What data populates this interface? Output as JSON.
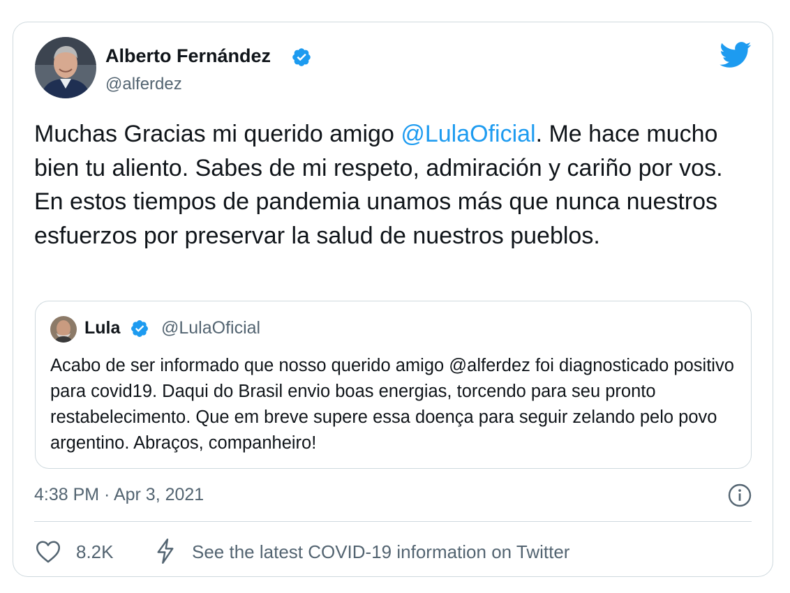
{
  "tweet": {
    "author": {
      "name": "Alberto Fernández",
      "handle": "@alferdez",
      "verified": true
    },
    "text": {
      "before_mention": "Muchas Gracias mi querido amigo ",
      "mention": "@LulaOficial",
      "after_mention": ". Me hace mucho bien tu aliento. Sabes de mi respeto, admiración y cariño por vos. En estos tiempos de pandemia unamos más que nunca nuestros esfuerzos por preservar la salud de nuestros pueblos."
    },
    "quoted": {
      "name": "Lula",
      "handle": "@LulaOficial",
      "verified": true,
      "text": "Acabo de ser informado que nosso querido amigo @alferdez foi diagnosticado positivo para covid19. Daqui do Brasil envio boas energias, torcendo para seu pronto restabelecimento. Que em breve supere essa doença para seguir zelando pelo povo argentino. Abraços, companheiro!"
    },
    "timestamp": "4:38 PM · Apr 3, 2021",
    "likes": "8.2K",
    "covid_info": "See the latest COVID-19 information on Twitter"
  },
  "icons": {
    "brand": "twitter-bird-icon",
    "verified": "verified-badge-icon",
    "info": "info-icon",
    "like": "heart-icon",
    "covid": "lightning-bolt-icon"
  },
  "colors": {
    "accent": "#1d9bf0",
    "text": "#0f1419",
    "secondary": "#536471",
    "border": "#cfd9de"
  }
}
